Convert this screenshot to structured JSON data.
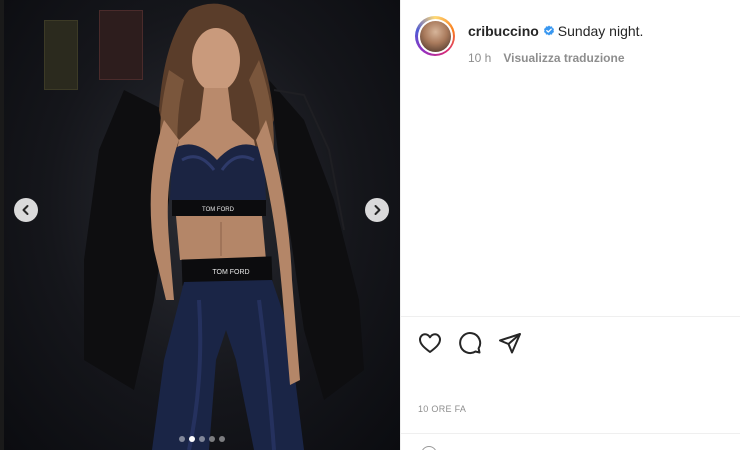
{
  "post": {
    "username": "cribuccino",
    "verified": true,
    "caption": "Sunday night.",
    "age": "10 h",
    "translate_label": "Visualizza traduzione",
    "timestamp": "10 ORE FA"
  },
  "media": {
    "slides_total": 5,
    "active_slide": 2,
    "waistband_text_top": "TOM FORD",
    "waistband_text_bottom": "TOM FORD"
  },
  "icons": {
    "prev": "chevron-left-icon",
    "next": "chevron-right-icon",
    "like": "heart-icon",
    "comment": "comment-icon",
    "share": "send-icon",
    "verified": "verified-badge-icon"
  },
  "colors": {
    "verified": "#3897f0",
    "text_primary": "#262626",
    "text_secondary": "#8e8e8e",
    "divider": "#efefef"
  }
}
